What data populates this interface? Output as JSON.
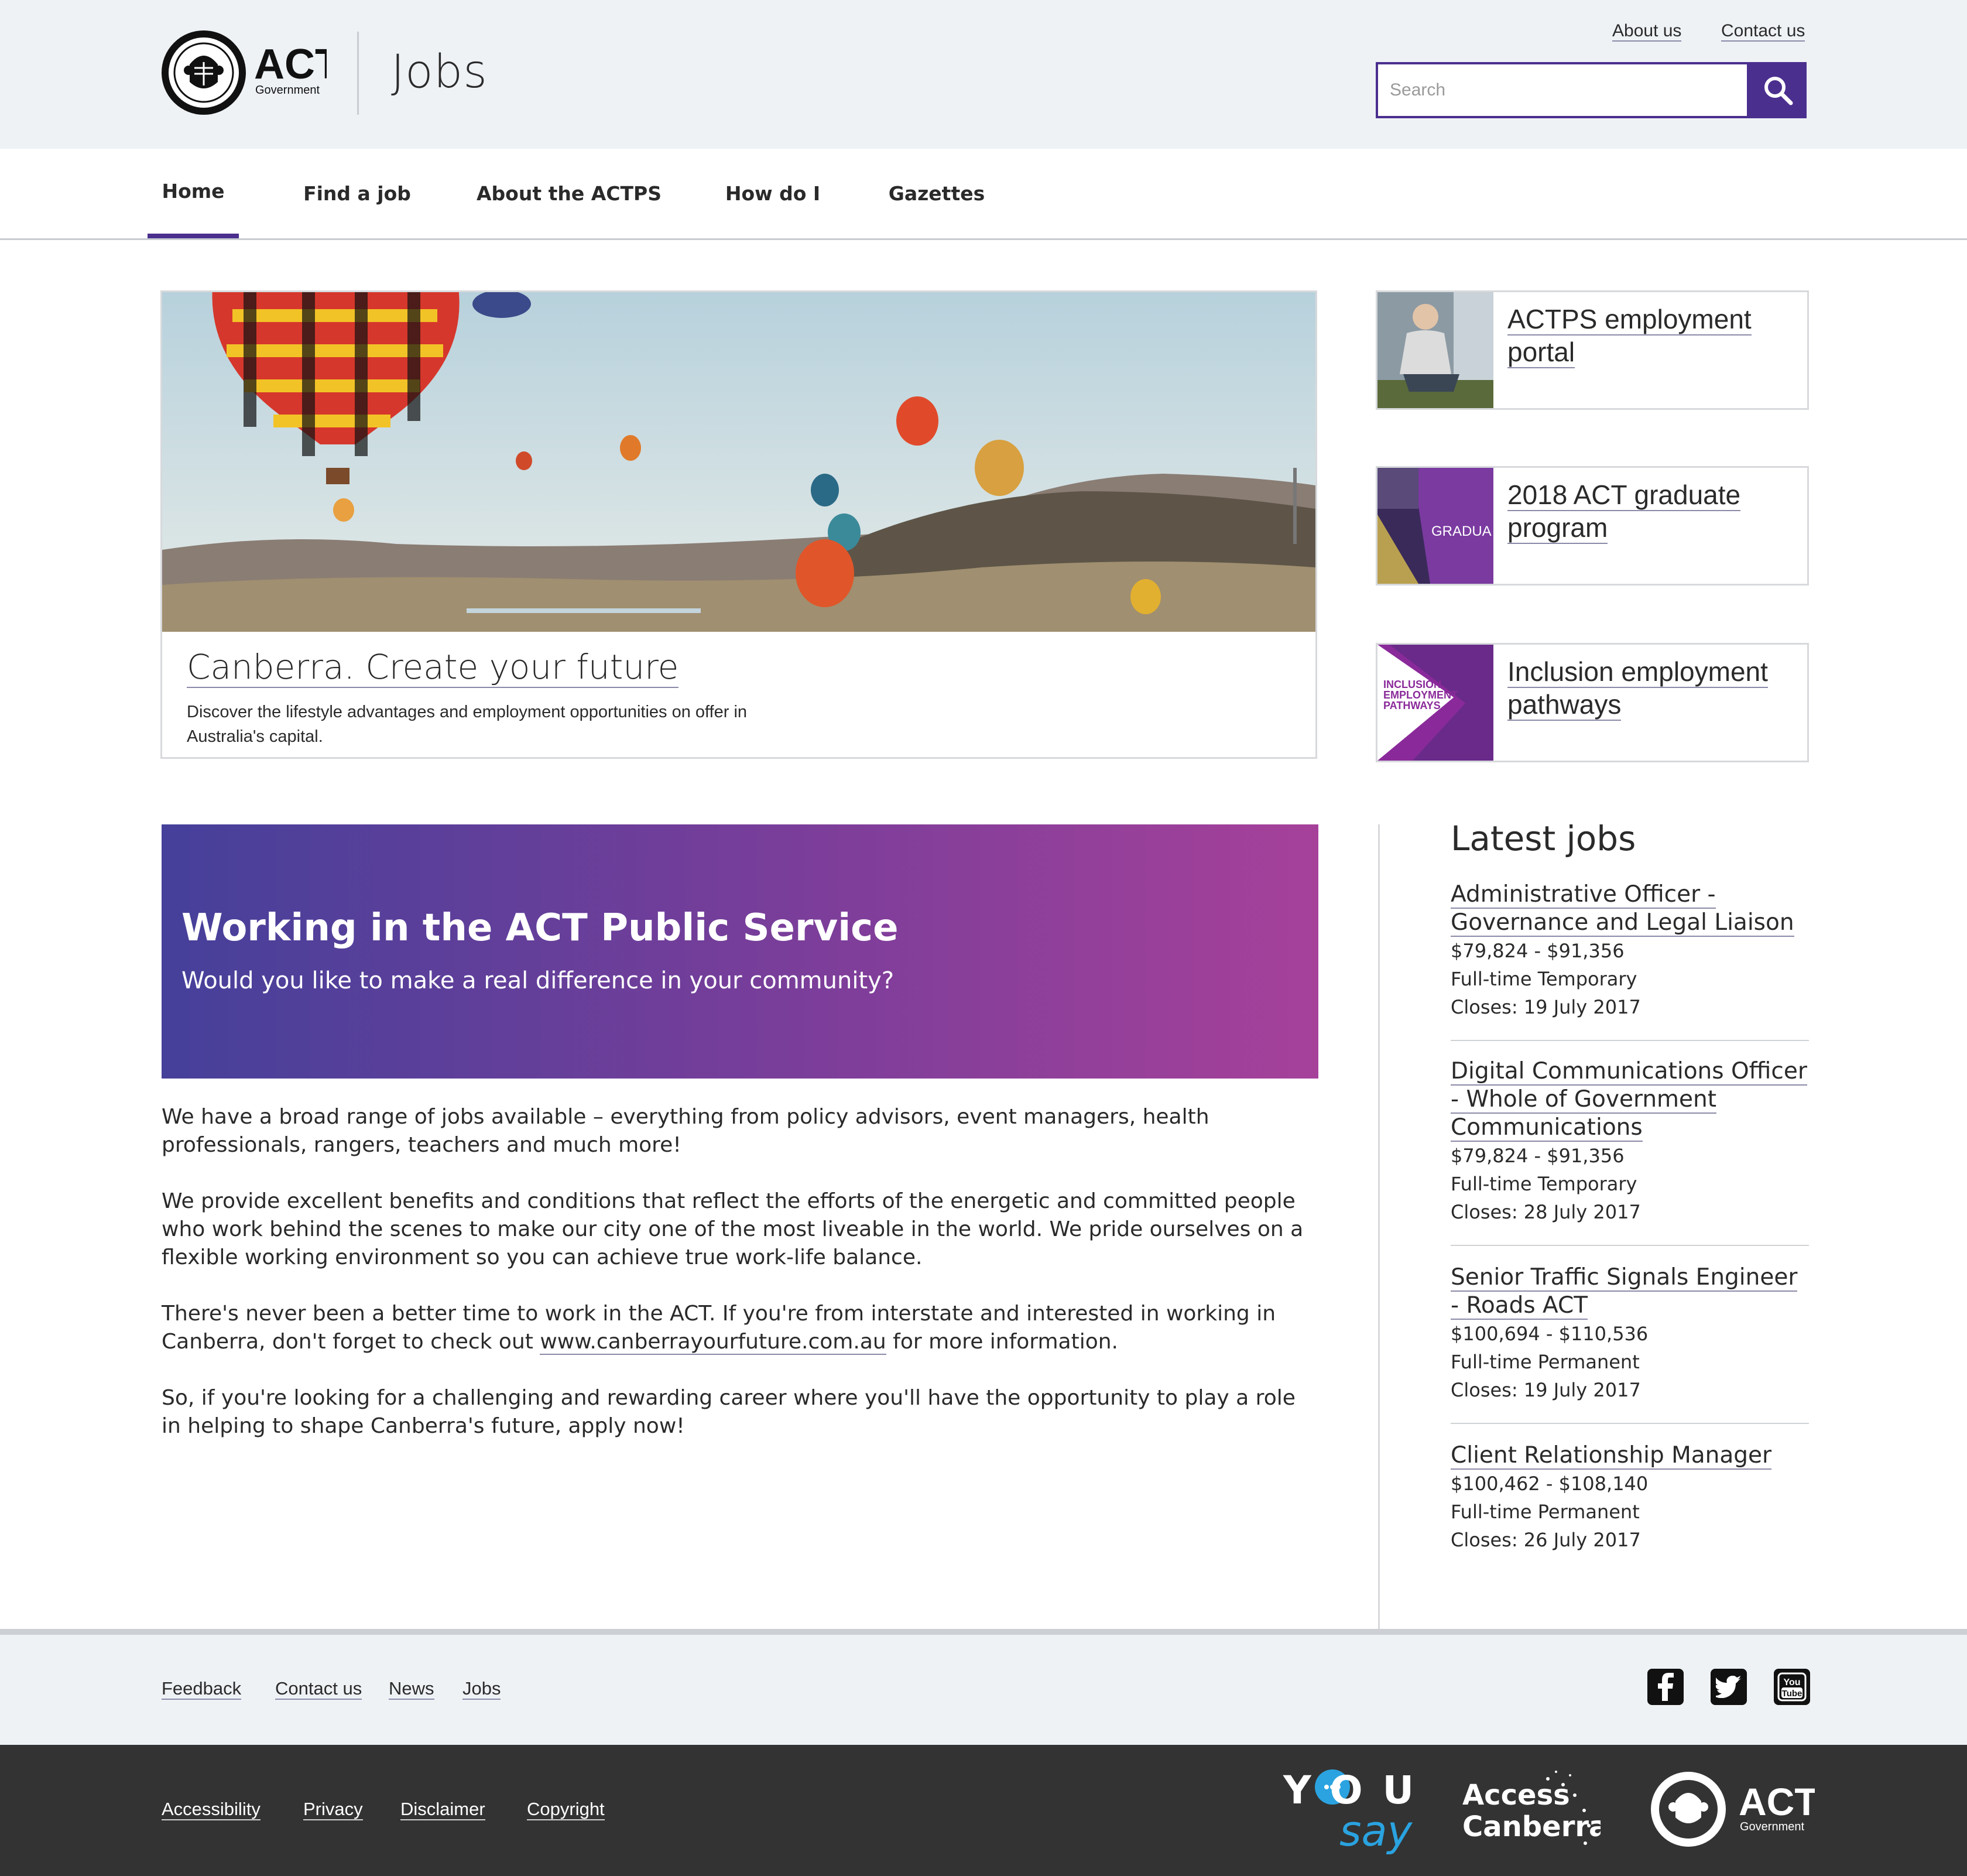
{
  "header": {
    "logo_text": "ACT",
    "logo_subtext": "Government",
    "site_name": "Jobs",
    "top_links": [
      "About us",
      "Contact us"
    ],
    "search_placeholder": "Search"
  },
  "nav": {
    "items": [
      "Home",
      "Find a job",
      "About the ACTPS",
      "How do I",
      "Gazettes"
    ],
    "active": "Home"
  },
  "hero": {
    "title": "Canberra. Create your future",
    "description": "Discover the lifestyle advantages and employment opportunities on offer in Australia's capital."
  },
  "side_cards": [
    {
      "title": "ACTPS employment portal"
    },
    {
      "title": "2018 ACT graduate program",
      "image_text": "GRADUA"
    },
    {
      "title": "Inclusion employment pathways",
      "image_text_lines": [
        "INCLUSION",
        "EMPLOYMENT",
        "PATHWAYS"
      ]
    }
  ],
  "banner": {
    "title": "Working in the ACT Public Service",
    "subtitle": "Would you like to make a real difference in your community?"
  },
  "body": {
    "p1": "We have a broad range of jobs available – everything from policy advisors, event managers, health professionals, rangers, teachers and much more!",
    "p2": "We provide excellent benefits and conditions that reflect the efforts of the energetic and committed people who work behind the scenes to make our city one of the most liveable in the world. We pride ourselves on a flexible working environment so you can achieve true work-life balance.",
    "p3_before": "There's never been a better time to work in the ACT. If you're from interstate and interested in working in Canberra, don't forget to check out ",
    "p3_link": "www.canberrayourfuture.com.au",
    "p3_after": " for more information.",
    "p4": "So, if you're looking for a challenging and rewarding career where you'll have the opportunity to play a role in helping to shape Canberra's future, apply now!"
  },
  "latest_jobs": {
    "heading": "Latest jobs",
    "jobs": [
      {
        "title": "Administrative Officer - Governance and Legal Liaison",
        "salary": "$79,824 - $91,356",
        "type": "Full-time Temporary",
        "closes": "Closes: 19 July 2017"
      },
      {
        "title": "Digital Communications Officer - Whole of Government Communications",
        "salary": "$79,824 - $91,356",
        "type": "Full-time Temporary",
        "closes": "Closes: 28 July 2017"
      },
      {
        "title": "Senior Traffic Signals Engineer - Roads ACT",
        "salary": "$100,694 - $110,536",
        "type": "Full-time Permanent",
        "closes": "Closes: 19 July 2017"
      },
      {
        "title": "Client Relationship Manager",
        "salary": "$100,462 - $108,140",
        "type": "Full-time Permanent",
        "closes": "Closes: 26 July 2017"
      }
    ]
  },
  "footer": {
    "top_links": [
      "Feedback",
      "Contact us",
      "News",
      "Jobs"
    ],
    "social_icons": [
      "facebook-icon",
      "twitter-icon",
      "youtube-icon"
    ],
    "youtube_text": [
      "You",
      "Tube"
    ],
    "bottom_links": [
      "Accessibility",
      "Privacy",
      "Disclaimer",
      "Copyright"
    ],
    "yoursay_text": "YOUR",
    "yoursay_script": "say",
    "access_canberra_lines": [
      "Access",
      "Canberra."
    ],
    "act_logo_text": "ACT",
    "act_logo_subtext": "Government"
  },
  "colors": {
    "brand_purple": "#4b2f8f",
    "banner_gradient_start": "#45409a",
    "banner_gradient_end": "#a6419a",
    "header_bg": "#eef2f5",
    "footer_dark": "#333333",
    "yoursay_blue": "#2aa3e0"
  }
}
